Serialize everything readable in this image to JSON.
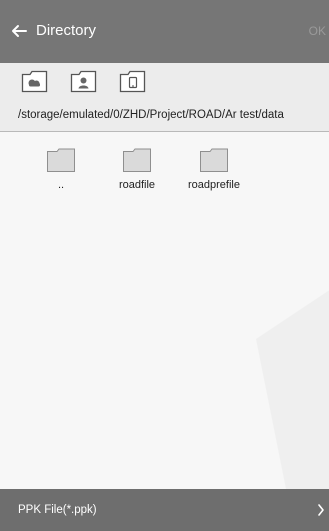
{
  "header": {
    "title": "Directory",
    "ok_label": "OK",
    "back_icon": "arrow-left-icon"
  },
  "shortcuts": [
    {
      "name": "cloud-folder-icon",
      "label": ""
    },
    {
      "name": "user-folder-icon",
      "label": ""
    },
    {
      "name": "device-folder-icon",
      "label": ""
    }
  ],
  "path": {
    "current": "/storage/emulated/0/ZHD/Project/ROAD/Ar test/data"
  },
  "files": [
    {
      "name": "..",
      "icon": "folder-icon"
    },
    {
      "name": "roadfile",
      "icon": "folder-icon"
    },
    {
      "name": "roadprefile",
      "icon": "folder-icon"
    }
  ],
  "footer": {
    "filter_label": "PPK File(*.ppk)",
    "chevron_icon": "chevron-right-icon"
  },
  "colors": {
    "header_bg": "#767676",
    "footer_bg": "#6e6e6e",
    "bar_bg": "#ececec",
    "page_bg": "#f7f7f7"
  }
}
